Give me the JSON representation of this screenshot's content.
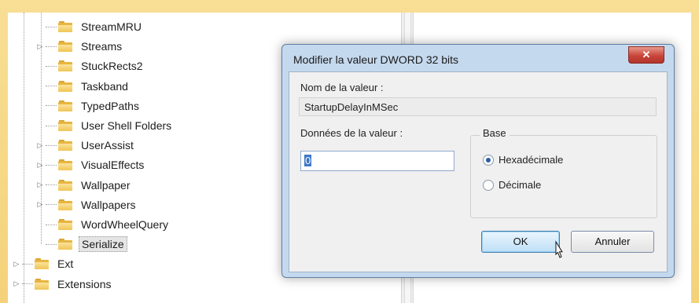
{
  "tree": {
    "items": [
      {
        "label": "StreamMRU",
        "expander": ""
      },
      {
        "label": "Streams",
        "expander": "▷"
      },
      {
        "label": "StuckRects2",
        "expander": ""
      },
      {
        "label": "Taskband",
        "expander": ""
      },
      {
        "label": "TypedPaths",
        "expander": ""
      },
      {
        "label": "User Shell Folders",
        "expander": ""
      },
      {
        "label": "UserAssist",
        "expander": "▷"
      },
      {
        "label": "VisualEffects",
        "expander": "▷"
      },
      {
        "label": "Wallpaper",
        "expander": "▷"
      },
      {
        "label": "Wallpapers",
        "expander": "▷"
      },
      {
        "label": "WordWheelQuery",
        "expander": ""
      },
      {
        "label": "Serialize",
        "expander": "",
        "selected": true
      }
    ],
    "parent_items": [
      {
        "label": "Ext",
        "expander": "▷"
      },
      {
        "label": "Extensions",
        "expander": "▷"
      }
    ]
  },
  "dialog": {
    "title": "Modifier la valeur DWORD 32 bits",
    "close_label": "✕",
    "value_name_label": "Nom de la valeur :",
    "value_name": "StartupDelayInMSec",
    "value_data_label": "Données de la valeur :",
    "value_data": "0",
    "base_label": "Base",
    "radio_hex": "Hexadécimale",
    "radio_dec": "Décimale",
    "base_selected": "hex",
    "ok_label": "OK",
    "cancel_label": "Annuler"
  },
  "icons": {
    "folder": "folder-icon",
    "cursor": "mouse-pointer-icon"
  },
  "colors": {
    "frame": "#f4d27a",
    "dialog_chrome": "#c5d9ee",
    "close_button": "#c9453a",
    "folder": "#e7b642"
  }
}
